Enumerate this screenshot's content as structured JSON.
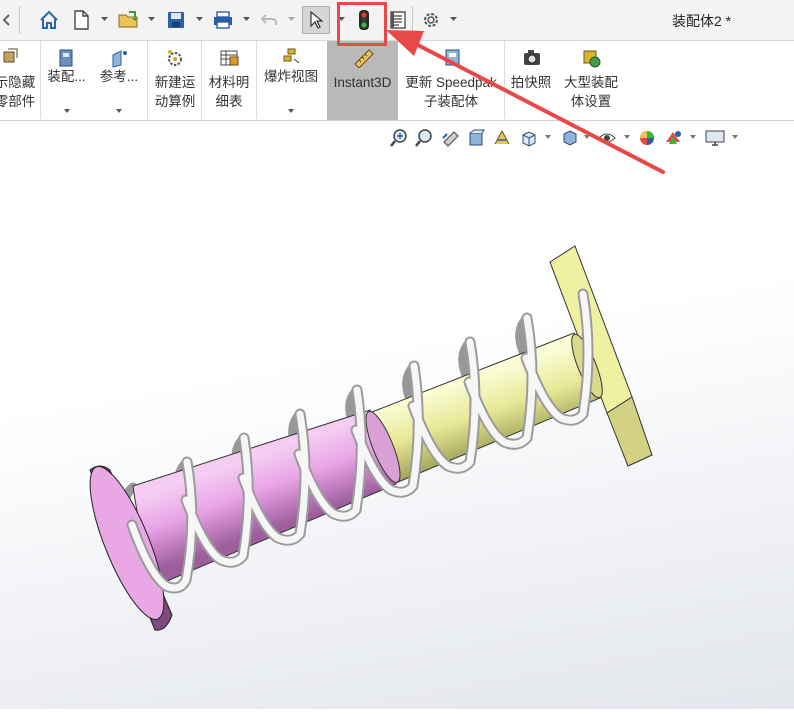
{
  "window": {
    "title": "装配体2 *"
  },
  "quick_access": {
    "icons": [
      "left-arrow-icon",
      "home-icon",
      "new-document-icon",
      "open-icon",
      "save-icon",
      "print-icon",
      "undo-icon",
      "select-icon",
      "traffic-light-icon",
      "file-properties-icon",
      "options-gear-icon"
    ]
  },
  "ribbon": {
    "items": [
      {
        "name": "show-hide-components",
        "label_line1": "示隐藏",
        "label_line2": "零部件",
        "icon": "show-hide-components-icon"
      },
      {
        "name": "assembly",
        "label_line1": "装配...",
        "label_line2": "",
        "icon": "assembly-icon",
        "has_dropdown": true
      },
      {
        "name": "reference",
        "label_line1": "参考...",
        "label_line2": "",
        "icon": "reference-geometry-icon",
        "has_dropdown": true
      },
      {
        "name": "new-motion-study",
        "label_line1": "新建运",
        "label_line2": "动算例",
        "icon": "motion-study-icon"
      },
      {
        "name": "bill-of-materials",
        "label_line1": "材料明",
        "label_line2": "细表",
        "icon": "bom-icon"
      },
      {
        "name": "exploded-view",
        "label_line1": "爆炸视图",
        "label_line2": "",
        "icon": "exploded-view-icon",
        "has_dropdown": true
      },
      {
        "name": "instant3d",
        "label_line1": "Instant3D",
        "label_line2": "",
        "icon": "instant3d-icon",
        "active": true
      },
      {
        "name": "update-speedpak",
        "label_line1": "更新 Speedpak",
        "label_line2": "子装配体",
        "icon": "speedpak-icon"
      },
      {
        "name": "take-snapshot",
        "label_line1": "拍快照",
        "label_line2": "",
        "icon": "camera-icon"
      },
      {
        "name": "large-assembly-settings",
        "label_line1": "大型装配",
        "label_line2": "体设置",
        "icon": "large-assembly-icon"
      }
    ]
  },
  "heads_up": {
    "icons": [
      "zoom-to-fit-icon",
      "zoom-to-area-icon",
      "previous-view-icon",
      "section-view-icon",
      "dynamic-annotation-icon",
      "view-orientation-icon",
      "display-style-icon",
      "hide-show-items-icon",
      "edit-appearance-icon",
      "apply-scene-icon",
      "view-settings-icon"
    ]
  },
  "colors": {
    "annotation": "#e84848",
    "pink_part": "#e7a6e4",
    "yellow_part": "#eaec9a",
    "spring": "#f4f4f4",
    "active_tab_bg": "#b9b9b9"
  }
}
